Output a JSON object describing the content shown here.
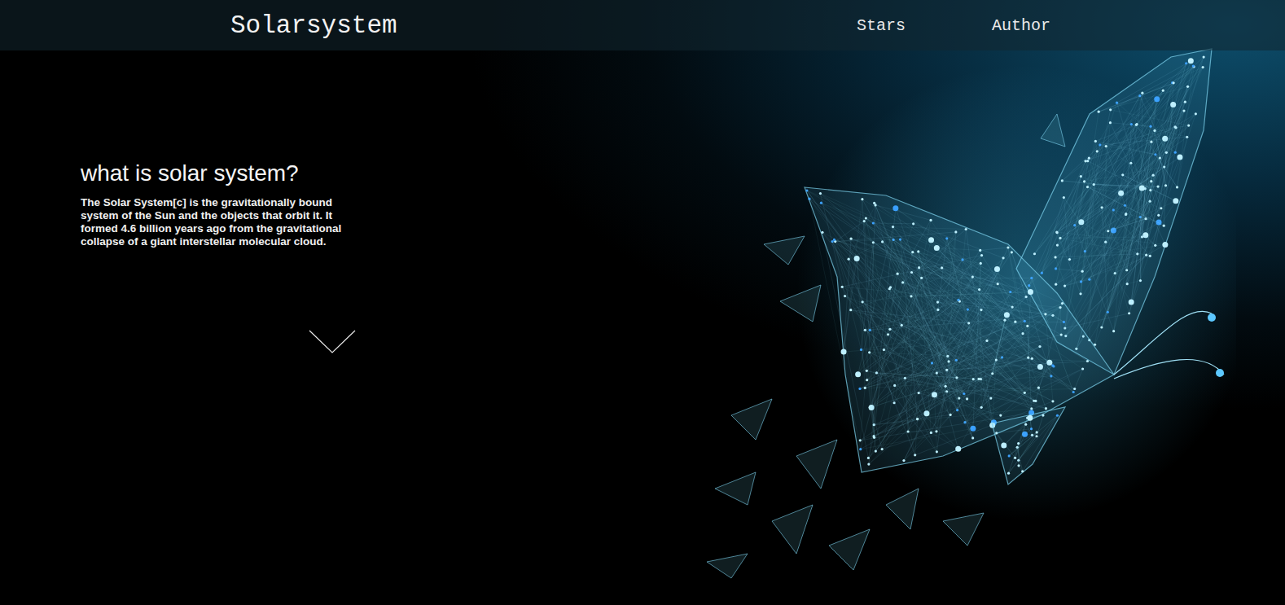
{
  "nav": {
    "brand": "Solarsystem",
    "links": [
      {
        "label": "Stars"
      },
      {
        "label": "Author"
      }
    ]
  },
  "hero": {
    "title": "what is solar system?",
    "text": "The Solar System[c] is the gravitationally bound system of the Sun and the objects that orbit it. It formed 4.6 billion years ago from the gravitational collapse of a giant interstellar molecular cloud."
  }
}
